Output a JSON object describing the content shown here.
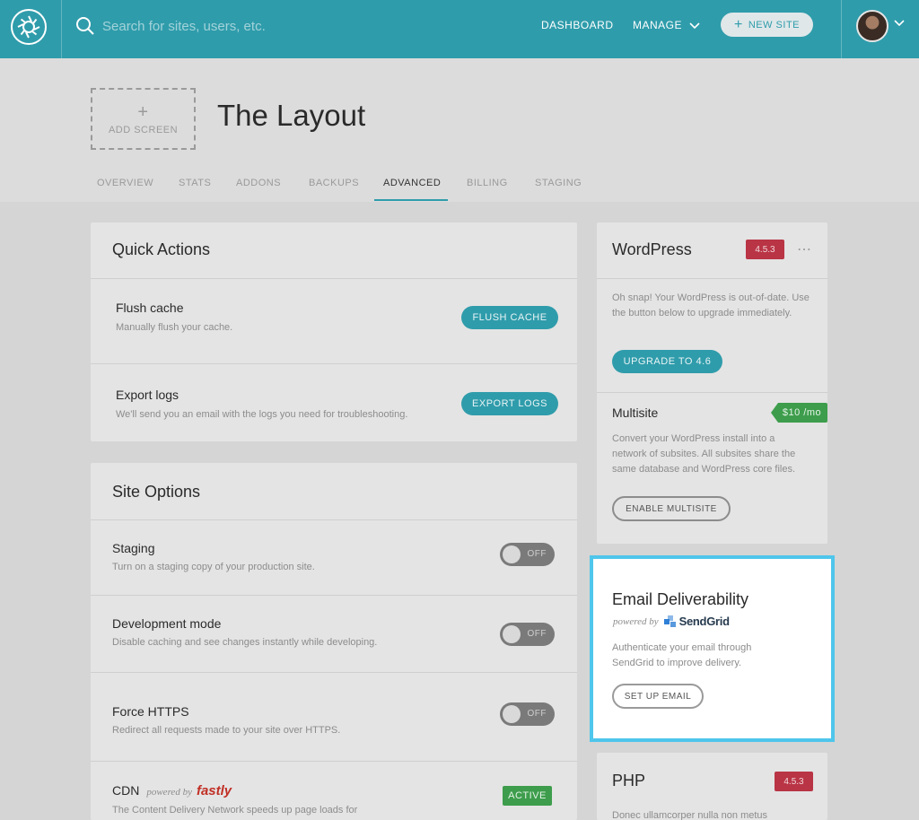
{
  "topbar": {
    "search_placeholder": "Search for sites, users, etc.",
    "dashboard": "DASHBOARD",
    "manage": "MANAGE",
    "new_site": "NEW SITE"
  },
  "header": {
    "add_screen": "ADD SCREEN",
    "title": "The Layout",
    "tabs": [
      "OVERVIEW",
      "STATS",
      "ADDONS",
      "BACKUPS",
      "ADVANCED",
      "BILLING",
      "STAGING"
    ],
    "active_tab": "ADVANCED"
  },
  "quick_actions": {
    "title": "Quick Actions",
    "flush": {
      "title": "Flush cache",
      "desc": "Manually flush your cache.",
      "button": "FLUSH CACHE"
    },
    "export": {
      "title": "Export logs",
      "desc": "We'll send you an email with the logs you need for troubleshooting.",
      "button": "EXPORT LOGS"
    }
  },
  "site_options": {
    "title": "Site Options",
    "staging": {
      "title": "Staging",
      "desc": "Turn on a staging copy of your production site.",
      "state": "OFF"
    },
    "dev_mode": {
      "title": "Development mode",
      "desc": "Disable caching and see changes instantly while developing.",
      "state": "OFF"
    },
    "https": {
      "title": "Force HTTPS",
      "desc": "Redirect all requests made to your site over HTTPS.",
      "state": "OFF"
    },
    "cdn": {
      "title": "CDN",
      "powered_by": "powered by",
      "brand": "fastly",
      "status": "ACTIVE",
      "desc": "The Content Delivery Network speeds up page loads for"
    }
  },
  "wordpress": {
    "title": "WordPress",
    "version": "4.5.3",
    "message": "Oh snap! Your WordPress is out-of-date. Use the button below to upgrade immediately.",
    "upgrade": "UPGRADE TO 4.6"
  },
  "multisite": {
    "title": "Multisite",
    "price": "$10 /mo",
    "desc": "Convert your WordPress install into a network of subsites. All subsites share the same database and WordPress core files.",
    "button": "ENABLE MULTISITE"
  },
  "email": {
    "title": "Email Deliverability",
    "powered_by": "powered by",
    "brand": "SendGrid",
    "desc": "Authenticate your email through SendGrid to improve delivery.",
    "button": "SET UP EMAIL"
  },
  "php": {
    "title": "PHP",
    "version": "4.5.3",
    "desc": "Donec ullamcorper nulla non metus"
  },
  "colors": {
    "brand_teal": "#2f9cab",
    "badge_red": "#b93445",
    "badge_green": "#3d9d4c",
    "highlight": "#4fc6ec"
  },
  "icons": [
    "logo-icon",
    "search-icon",
    "chevron-down-icon",
    "plus-icon",
    "avatar",
    "more-dots-icon",
    "sendgrid-logo-icon"
  ]
}
